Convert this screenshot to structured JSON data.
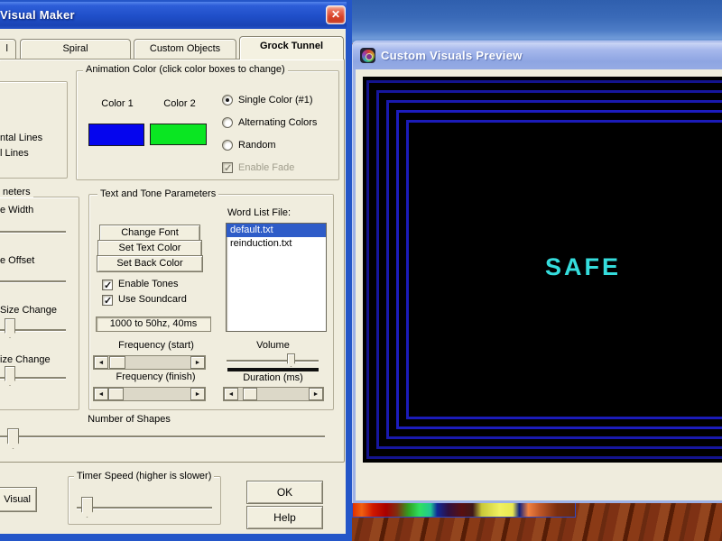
{
  "dialog": {
    "title": "Visual Maker",
    "tabs": {
      "stub": "l",
      "spiral": "Spiral",
      "custom_objects": "Custom Objects",
      "grock_tunnel": "Grock Tunnel"
    },
    "animation_color": {
      "title": "Animation Color (click color boxes to change)",
      "color1_label": "Color 1",
      "color2_label": "Color 2",
      "color1_hex": "#0505ee",
      "color2_hex": "#0ae622",
      "radio_single": "Single Color (#1)",
      "radio_alternating": "Alternating Colors",
      "radio_random": "Random",
      "enable_fade": "Enable Fade"
    },
    "lines_group": {
      "item1": "ntal Lines",
      "item2": "l Lines"
    },
    "params_group": {
      "title": "neters",
      "label_width": "e Width",
      "label_offset": "e Offset",
      "label_size_change": "Size Change",
      "label_size_change2": "ize Change"
    },
    "text_tone": {
      "title": "Text and Tone Parameters",
      "btn_change_font": "Change Font",
      "btn_set_text_color": "Set Text Color",
      "btn_set_back_color": "Set Back Color",
      "chk_enable_tones": "Enable Tones",
      "chk_use_soundcard": "Use Soundcard",
      "tone_summary": "1000 to 50hz, 40ms",
      "word_list_label": "Word List File:",
      "word_list_items": [
        "default.txt",
        "reinduction.txt"
      ],
      "word_list_selected": "default.txt",
      "label_freq_start": "Frequency (start)",
      "label_freq_finish": "Frequency (finish)",
      "label_volume": "Volume",
      "label_duration": "Duration (ms)"
    },
    "label_number_of_shapes": "Number of Shapes",
    "btn_visual": "Visual",
    "timer_group_title": "Timer Speed (higher is slower)",
    "btn_ok": "OK",
    "btn_help": "Help"
  },
  "preview": {
    "title": "Custom Visuals Preview",
    "canvas_word": "SAFE",
    "word_color": "#35dcdc",
    "tunnel_color": "#1b1bb8"
  },
  "icons": {
    "close": "✕",
    "arrow_left": "◄",
    "arrow_right": "►"
  }
}
